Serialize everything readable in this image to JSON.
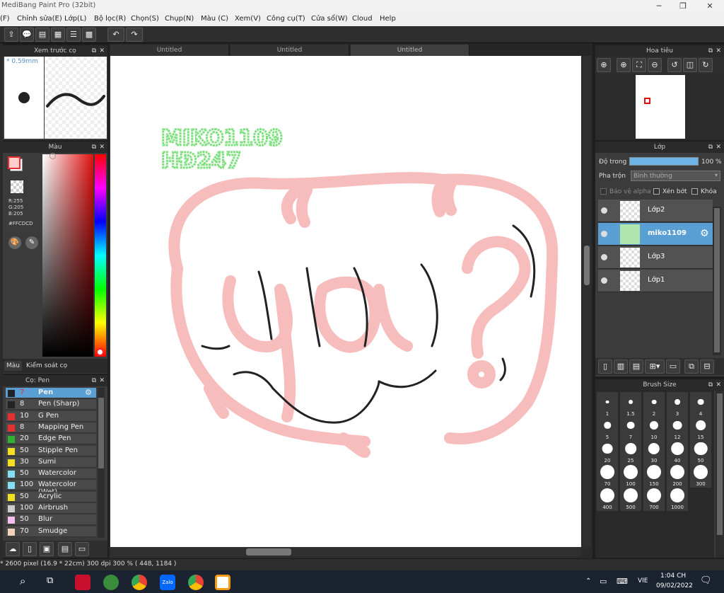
{
  "app": {
    "title": "MediBang Paint Pro (32bit)"
  },
  "menu": [
    "(F)",
    "Chỉnh sửa(E)",
    "Lớp(L)",
    "Bộ lọc(R)",
    "Chọn(S)",
    "Chụp(N)",
    "Màu (C)",
    "Xem(V)",
    "Công cụ(T)",
    "Cửa sổ(W)",
    "Cloud",
    "Help"
  ],
  "toolbar": {
    "undo_label": "↶",
    "redo_label": "↷"
  },
  "brush_preview": {
    "title": "Xem trước cọ",
    "size_label": "* 0.59mm"
  },
  "color_panel": {
    "title": "Màu",
    "rgb": {
      "r": "R:255",
      "g": "G:205",
      "b": "B:205"
    },
    "hex": "#FFCDCD",
    "tabs": [
      "Màu",
      "Kiểm soát cọ"
    ],
    "main_color": "#ffcdcd"
  },
  "brush_list": {
    "title": "Cọ: Pen",
    "items": [
      {
        "size": "7",
        "name": "Pen",
        "color": "#222222",
        "selected": true
      },
      {
        "size": "8",
        "name": "Pen (Sharp)",
        "color": "#222222"
      },
      {
        "size": "10",
        "name": "G Pen",
        "color": "#e83030"
      },
      {
        "size": "8",
        "name": "Mapping Pen",
        "color": "#e83030"
      },
      {
        "size": "20",
        "name": "Edge Pen",
        "color": "#30b030"
      },
      {
        "size": "50",
        "name": "Stipple Pen",
        "color": "#f0e020"
      },
      {
        "size": "30",
        "name": "Sumi",
        "color": "#f0e020"
      },
      {
        "size": "50",
        "name": "Watercolor",
        "color": "#80e0f0"
      },
      {
        "size": "100",
        "name": "Watercolor (Wet)",
        "color": "#80e0f0"
      },
      {
        "size": "50",
        "name": "Acrylic",
        "color": "#f0e020"
      },
      {
        "size": "100",
        "name": "Airbrush",
        "color": "#cccccc"
      },
      {
        "size": "50",
        "name": "Blur",
        "color": "#f5c0f0"
      },
      {
        "size": "70",
        "name": "Smudge",
        "color": "#f5d0c0"
      }
    ]
  },
  "tabs": [
    "Untitled",
    "Untitled",
    "Untitled"
  ],
  "canvas_text": {
    "line1": "MIKO1109",
    "line2": "HĐ247"
  },
  "navigator": {
    "title": "Hoa tiêu"
  },
  "layers": {
    "title": "Lớp",
    "opacity_label": "Độ trong",
    "opacity_value": "100 %",
    "blend_label": "Pha trộn",
    "blend_value": "Bình thường",
    "protect_alpha": "Bảo vệ alpha",
    "clipping": "Xén bớt",
    "lock": "Khóa",
    "items": [
      {
        "name": "Lớp2",
        "selected": false
      },
      {
        "name": "miko1109",
        "selected": true
      },
      {
        "name": "Lớp3",
        "selected": false
      },
      {
        "name": "Lớp1",
        "selected": false
      }
    ]
  },
  "brush_size": {
    "title": "Brush Size",
    "sizes": [
      "1",
      "1.5",
      "2",
      "3",
      "4",
      "5",
      "7",
      "10",
      "12",
      "15",
      "20",
      "25",
      "30",
      "40",
      "50",
      "70",
      "100",
      "150",
      "200",
      "300",
      "400",
      "500",
      "700",
      "1000"
    ]
  },
  "status": {
    "text": "* 2600 pixel  (16.9 * 22cm)  300 dpi  300 %  ( 448, 1184 )"
  },
  "taskbar": {
    "lang": "VIE",
    "time": "1:04 CH",
    "date": "09/02/2022"
  },
  "colors": {
    "accent": "#5a9fd4",
    "sketch_pink": "#f7b5b5",
    "text_green": "#7ee07e"
  }
}
